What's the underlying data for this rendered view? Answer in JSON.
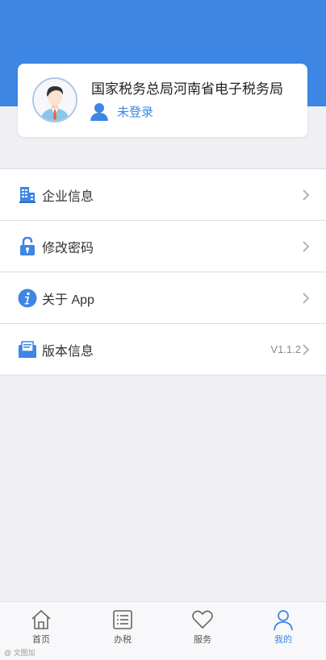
{
  "colors": {
    "brand": "#3d86e3",
    "background": "#efeff4"
  },
  "profile": {
    "org_name": "国家税务总局河南省电子税务局",
    "login_status": "未登录",
    "avatar_icon": "person-avatar-icon",
    "user_icon": "user-icon"
  },
  "menu": {
    "items": [
      {
        "label": "企业信息",
        "icon": "building-icon",
        "value": ""
      },
      {
        "label": "修改密码",
        "icon": "lock-icon",
        "value": ""
      },
      {
        "label": "关于 App",
        "icon": "info-icon",
        "value": ""
      },
      {
        "label": "版本信息",
        "icon": "envelope-icon",
        "value": "V1.1.2"
      }
    ]
  },
  "tabbar": {
    "tabs": [
      {
        "label": "首页",
        "icon": "home-icon",
        "active": false
      },
      {
        "label": "办税",
        "icon": "list-icon",
        "active": false
      },
      {
        "label": "服务",
        "icon": "heart-icon",
        "active": false
      },
      {
        "label": "我的",
        "icon": "person-icon",
        "active": true
      }
    ]
  },
  "watermark": "@ 文图加"
}
